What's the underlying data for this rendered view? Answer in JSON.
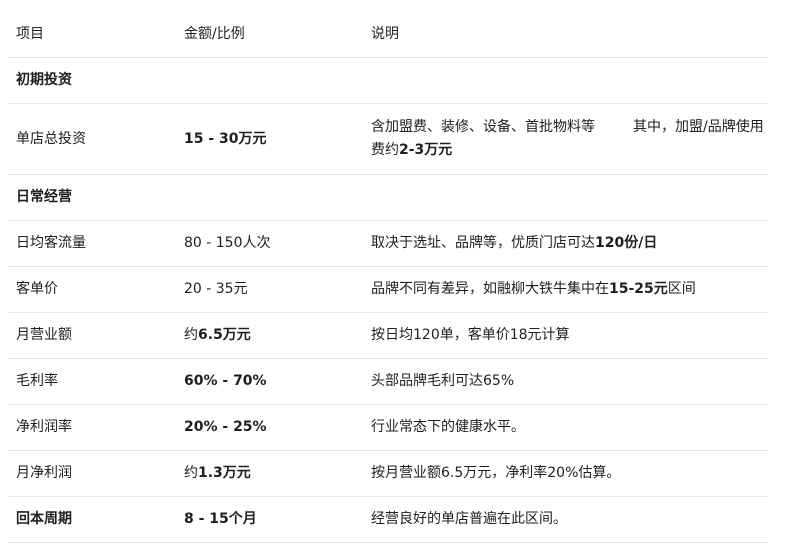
{
  "header": {
    "col1": "项目",
    "col2": "金额/比例",
    "col3": "说明"
  },
  "sections": {
    "initial": "初期投资",
    "daily": "日常经营"
  },
  "rows": {
    "total_investment": {
      "label": "单店总投资",
      "value": "15 - 30万元",
      "desc_a": "含加盟费、装修、设备、首批物料等",
      "desc_b": "其中，加盟/品牌使用费约",
      "desc_b_bold": "2-3万元"
    },
    "traffic": {
      "label": "日均客流量",
      "value": "80 - 150人次",
      "desc": "取决于选址、品牌等，优质门店可达",
      "desc_bold": "120份/日"
    },
    "ticket": {
      "label": "客单价",
      "value": "20 - 35元",
      "desc": "品牌不同有差异，如融柳大铁牛集中在",
      "desc_bold": "15-25元",
      "desc_tail": "区间"
    },
    "revenue": {
      "label": "月营业额",
      "value_prefix": "约",
      "value_bold": "6.5万元",
      "desc": "按日均120单，客单价18元计算"
    },
    "gross_margin": {
      "label": "毛利率",
      "value": "60% - 70%",
      "desc": "头部品牌毛利可达65%"
    },
    "net_margin": {
      "label": "净利润率",
      "value": "20% - 25%",
      "desc": "行业常态下的健康水平。"
    },
    "net_profit": {
      "label": "月净利润",
      "value_prefix": "约",
      "value_bold": "1.3万元",
      "desc": "按月营业额6.5万元，净利率20%估算。"
    },
    "payback": {
      "label": "回本周期",
      "value": "8 - 15个月",
      "desc": "经营良好的单店普遍在此区间。"
    }
  }
}
